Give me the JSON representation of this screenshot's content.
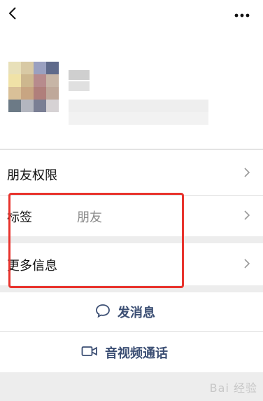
{
  "rows": {
    "permissions": {
      "label": "朋友权限"
    },
    "tag": {
      "label": "标签",
      "value": "朋友"
    },
    "more_info": {
      "label": "更多信息"
    }
  },
  "actions": {
    "message": {
      "label": "发消息"
    },
    "call": {
      "label": "音视频通话"
    }
  },
  "watermark": {
    "text": "Bai 经验"
  },
  "colors": {
    "accent": "#3b4e73",
    "highlight": "#e8332d",
    "background": "#ededed"
  },
  "icons": {
    "back": "chevron-left-icon",
    "more": "more-horizontal-icon",
    "message": "chat-bubble-icon",
    "call": "video-call-icon",
    "chevron": "chevron-right-icon"
  }
}
